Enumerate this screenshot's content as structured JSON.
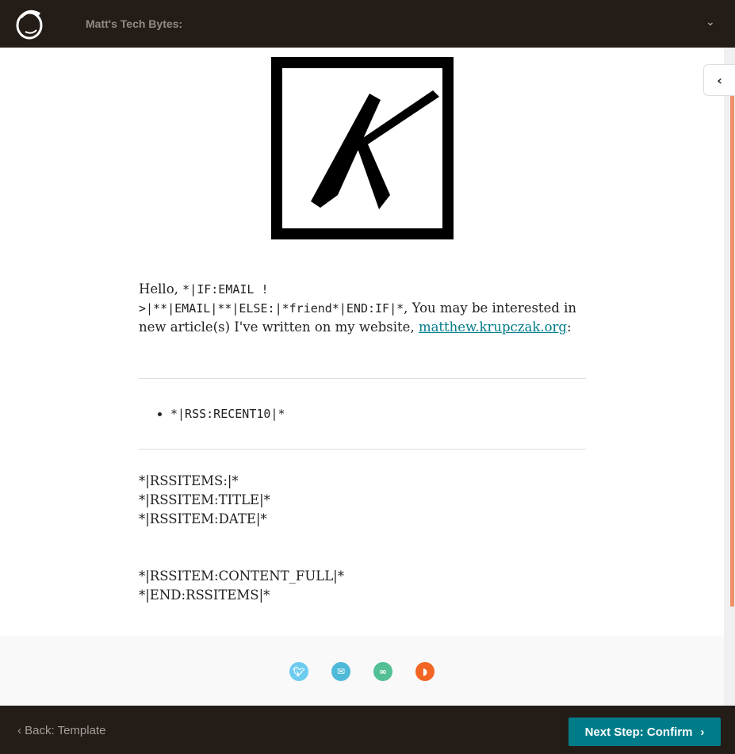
{
  "header": {
    "title": "Matt's Tech Bytes:"
  },
  "content": {
    "greeting_1": "Hello, ",
    "greeting_code_1": "*|IF:EMAIL !",
    "greeting_code_2": ">|**|EMAIL|**|ELSE:|*friend*|END:IF|*",
    "greeting_2": ", You may be interested in new article(s) I've written on my website, ",
    "link": "matthew.krupczak.org",
    "greeting_3": ":",
    "rss_recent": "*|RSS:RECENT10|*",
    "rss_lines": [
      "*|RSSITEMS:|*",
      "*|RSSITEM:TITLE|*",
      "*|RSSITEM:DATE|*",
      "*|RSSITEM:CONTENT_FULL|*",
      "*|END:RSSITEMS|*"
    ]
  },
  "social": {
    "colors": {
      "twitter": "#6ecbf0",
      "email": "#4fb9d8",
      "link": "#52bf94",
      "rss": "#f26522"
    }
  },
  "footer": {
    "back_label": "Back: Template",
    "next_label": "Next Step: Confirm"
  }
}
